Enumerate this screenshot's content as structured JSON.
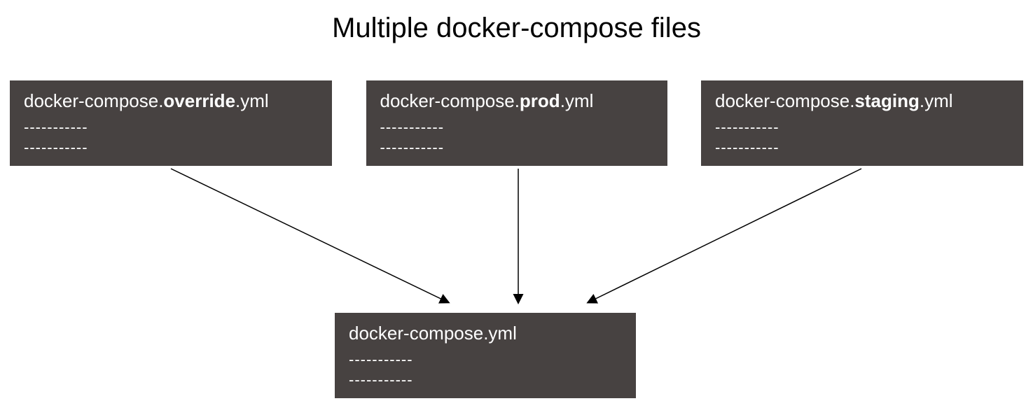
{
  "title": "Multiple docker-compose files",
  "files": {
    "override": {
      "prefix": "docker-compose.",
      "bold": "override",
      "suffix": ".yml",
      "dashes1": "-----------",
      "dashes2": "-----------"
    },
    "prod": {
      "prefix": "docker-compose.",
      "bold": "prod",
      "suffix": ".yml",
      "dashes1": "-----------",
      "dashes2": "-----------"
    },
    "staging": {
      "prefix": "docker-compose.",
      "bold": "staging",
      "suffix": ".yml",
      "dashes1": "-----------",
      "dashes2": "-----------"
    },
    "base": {
      "name": "docker-compose.yml",
      "dashes1": "-----------",
      "dashes2": "-----------"
    }
  }
}
